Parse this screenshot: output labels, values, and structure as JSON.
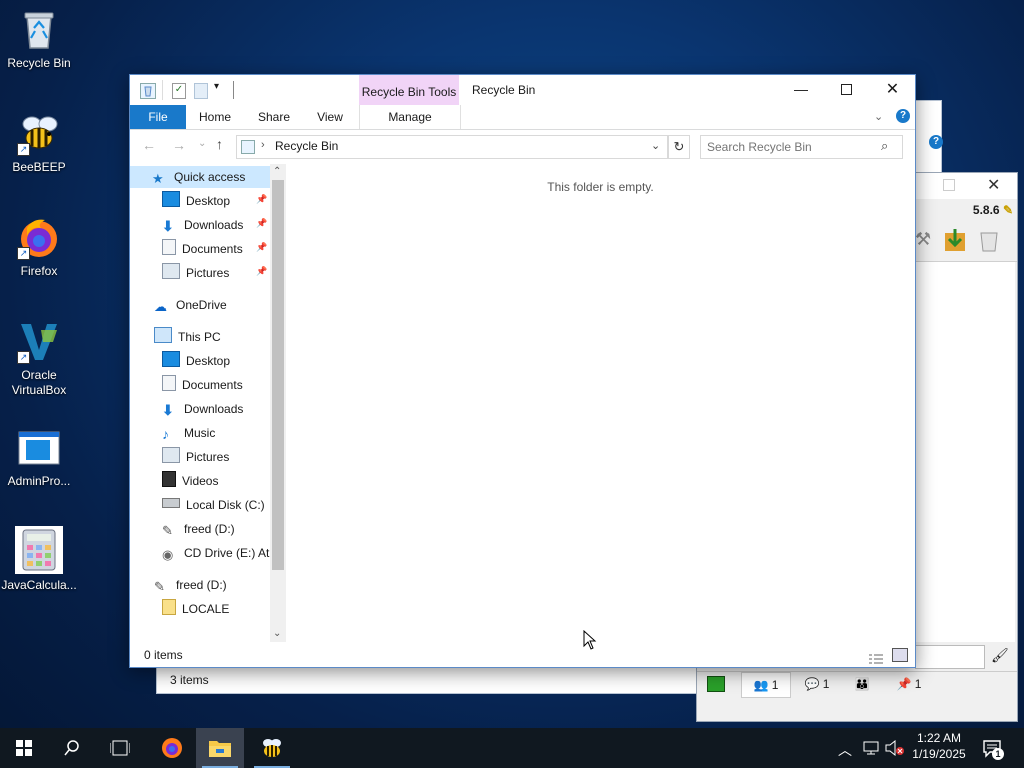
{
  "desktop": {
    "icons": [
      {
        "label": "Recycle Bin"
      },
      {
        "label": "BeeBEEP"
      },
      {
        "label": "Firefox"
      },
      {
        "label": "Oracle\nVirtualBox"
      },
      {
        "label": "AdminPro..."
      },
      {
        "label": "JavaCalcula..."
      }
    ]
  },
  "background_windows": {
    "explorer_status": "3 items",
    "beebeep_version": "5.8.6",
    "beebeep_tabs": [
      "1",
      "1",
      "1"
    ]
  },
  "explorer": {
    "title": "Recycle Bin",
    "contextual_tab_group": "Recycle Bin Tools",
    "tabs": {
      "file": "File",
      "home": "Home",
      "share": "Share",
      "view": "View",
      "manage": "Manage"
    },
    "address": "Recycle Bin",
    "search_placeholder": "Search Recycle Bin",
    "empty_message": "This folder is empty.",
    "status": "0 items",
    "nav": {
      "quick_access": "Quick access",
      "quick_items": [
        "Desktop",
        "Downloads",
        "Documents",
        "Pictures"
      ],
      "onedrive": "OneDrive",
      "this_pc": "This PC",
      "pc_items": [
        "Desktop",
        "Documents",
        "Downloads",
        "Music",
        "Pictures",
        "Videos",
        "Local Disk (C:)",
        "freed (D:)",
        "CD Drive (E:) Atla"
      ],
      "freed": "freed (D:)",
      "locale": "LOCALE"
    }
  },
  "taskbar": {
    "time": "1:22 AM",
    "date": "1/19/2025",
    "notification_count": "1"
  },
  "colors": {
    "accent": "#1979ca",
    "contextual": "#f1d4f7",
    "taskbar": "#101820"
  }
}
